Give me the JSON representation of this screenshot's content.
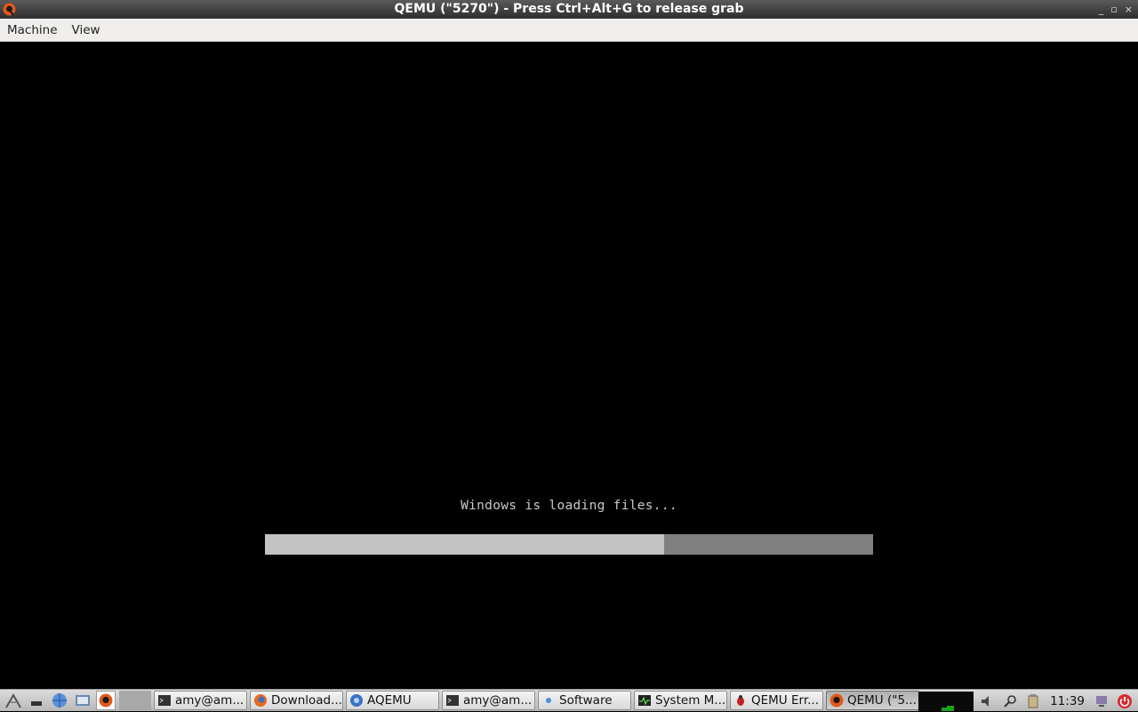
{
  "window": {
    "title": "QEMU (\"5270\") - Press Ctrl+Alt+G to release grab",
    "icon": "qemu-icon",
    "controls": [
      "_",
      "▫",
      "×"
    ]
  },
  "menu": {
    "items": [
      "Machine",
      "View"
    ]
  },
  "guest": {
    "message": "Windows is loading files...",
    "progress": 0.657,
    "colors": {
      "bar_track": "#808080",
      "bar_fill": "#c2c2c2",
      "text": "#c9c9c9"
    }
  },
  "taskbar": {
    "launchers": [
      "menu-icon",
      "show-desktop-icon",
      "network-icon",
      "file-manager-icon",
      "qemu-icon",
      "blank-icon"
    ],
    "tasks": [
      {
        "label": "amy@am...",
        "icon": "terminal-icon",
        "width": 105
      },
      {
        "label": "Download...",
        "icon": "firefox-icon",
        "width": 105
      },
      {
        "label": "AQEMU",
        "icon": "aqemu-icon",
        "width": 105
      },
      {
        "label": "amy@am...",
        "icon": "terminal-icon",
        "width": 105
      },
      {
        "label": "Software",
        "icon": "software-icon",
        "width": 105
      },
      {
        "label": "System M...",
        "icon": "system-monitor-icon",
        "width": 105
      },
      {
        "label": "QEMU Err...",
        "icon": "bug-icon",
        "width": 105
      },
      {
        "label": "QEMU (\"5...",
        "icon": "qemu-icon",
        "width": 105,
        "active": true
      }
    ],
    "clock": "11:39"
  }
}
